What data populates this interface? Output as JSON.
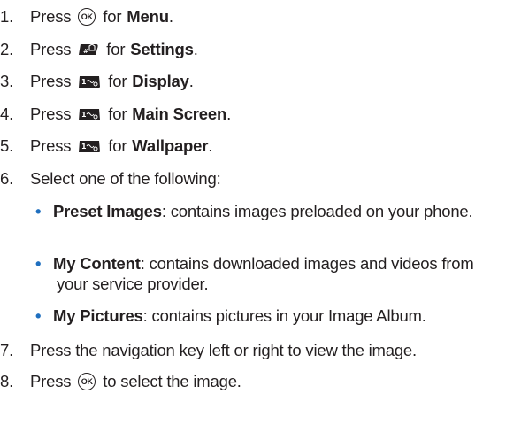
{
  "steps": [
    {
      "num": "1.",
      "press": "Press",
      "key_icon": "ok-key-icon",
      "key_label": "OK",
      "for": "for",
      "term": "Menu",
      "end": "."
    },
    {
      "num": "2.",
      "press": "Press",
      "key_icon": "hash-key-icon",
      "key_label": "#",
      "for": "for",
      "term": "Settings",
      "end": "."
    },
    {
      "num": "3.",
      "press": "Press",
      "key_icon": "one-key-icon",
      "key_label": "1",
      "for": "for",
      "term": "Display",
      "end": "."
    },
    {
      "num": "4.",
      "press": "Press",
      "key_icon": "one-key-icon",
      "key_label": "1",
      "for": "for",
      "term": "Main Screen",
      "end": "."
    },
    {
      "num": "5.",
      "press": "Press",
      "key_icon": "one-key-icon",
      "key_label": "1",
      "for": "for",
      "term": "Wallpaper",
      "end": "."
    },
    {
      "num": "6.",
      "text": "Select one of the following:"
    },
    {
      "num": "7.",
      "text": "Press the navigation key left or right to view the image."
    },
    {
      "num": "8.",
      "press": "Press",
      "key_icon": "ok-key-icon",
      "key_label": "OK",
      "after": "to select the image."
    }
  ],
  "options": [
    {
      "term": "Preset Images",
      "desc": ": contains images preloaded on your phone."
    },
    {
      "term": "My Content",
      "desc": ": contains downloaded images and videos from your service provider."
    },
    {
      "term": "My Pictures",
      "desc": ": contains pictures in your Image Album."
    }
  ],
  "colors": {
    "text": "#231f20",
    "bullet": "#1f6fbf",
    "key_fill": "#231f20"
  }
}
